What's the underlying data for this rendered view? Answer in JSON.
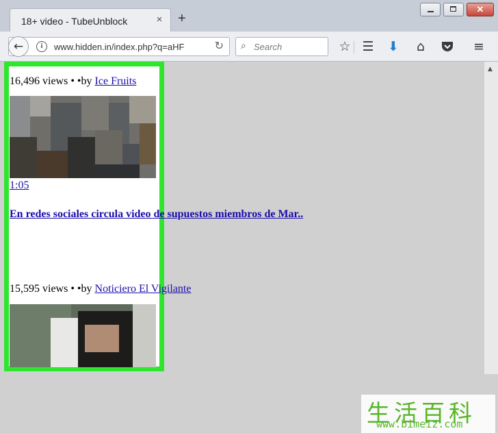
{
  "browser": {
    "tab_title": "18+ video - TubeUnblock",
    "tab_close": "×",
    "new_tab": "+",
    "url": "www.hidden.in/index.php?q=aHF",
    "search_placeholder": "Search",
    "window_close": "✕"
  },
  "videos": [
    {
      "views": "16,496 views • •by ",
      "author": "Ice Fruits",
      "duration": "1:05",
      "title": "En redes sociales circula video de supuestos miembros de Mar.."
    },
    {
      "views": "15,595 views • •by ",
      "author": "Noticiero El Vigilante"
    }
  ],
  "highlight_color": "#2ee62e",
  "watermark": {
    "chinese": "生活百科",
    "url": "www.bimeiz.com"
  }
}
